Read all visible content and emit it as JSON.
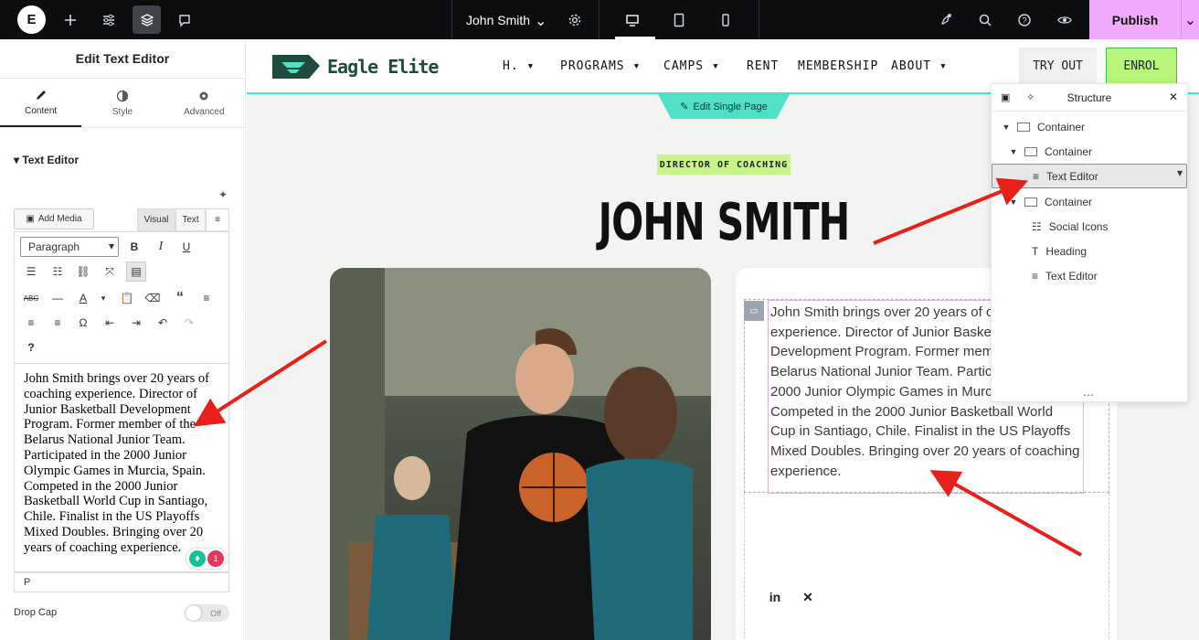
{
  "topbar": {
    "logo": "E",
    "document_title": "John Smith",
    "publish_label": "Publish"
  },
  "panel": {
    "title": "Edit Text Editor",
    "tabs": [
      {
        "label": "Content",
        "icon": "pencil-icon"
      },
      {
        "label": "Style",
        "icon": "half-circle-icon"
      },
      {
        "label": "Advanced",
        "icon": "gear-icon"
      }
    ],
    "section_title": "Text Editor",
    "add_media_label": "Add Media",
    "visual_label": "Visual",
    "text_label": "Text",
    "format_select": "Paragraph",
    "editor_text": "John Smith brings over 20 years of coaching experience. Director of Junior Basketball Development Program. Former member of the Belarus National Junior Team. Participated in the 2000 Junior Olympic Games in Murcia, Spain. Competed in the 2000 Junior Basketball World Cup in Santiago, Chile. Finalist in the US Playoffs Mixed Doubles. Bringing over 20 years of coaching experience.",
    "path_label": "P",
    "badge_count": "1",
    "drop_cap_label": "Drop Cap",
    "drop_cap_value": "Off"
  },
  "site": {
    "brand": "Eagle Elite",
    "nav": [
      {
        "label": "H.",
        "dropdown": true
      },
      {
        "label": "PROGRAMS",
        "dropdown": true
      },
      {
        "label": "CAMPS",
        "dropdown": true
      },
      {
        "label": "RENT",
        "dropdown": false
      },
      {
        "label": "MEMBERSHIP",
        "dropdown": false
      },
      {
        "label": "ABOUT",
        "dropdown": true
      }
    ],
    "try_out": "TRY OUT",
    "enrol": "ENROL",
    "edit_page": "Edit Single Page",
    "role_tag": "DIRECTOR OF COACHING",
    "name": "JOHN SMITH",
    "bio": "John Smith brings over 20 years of coaching experience. Director of Junior Basketball Development Program. Former member of the Belarus National Junior Team. Participated in the 2000 Junior Olympic Games in Murcia, Spain. Competed in the 2000 Junior Basketball World Cup in Santiago, Chile. Finalist in the US Playoffs Mixed Doubles. Bringing over 20 years of coaching experience.",
    "accent_color": "#4fe0c6",
    "tag_color": "#c8f58a"
  },
  "structure": {
    "title": "Structure",
    "items": [
      {
        "label": "Container",
        "depth": 0,
        "expanded": true
      },
      {
        "label": "Container",
        "depth": 1,
        "expanded": true
      },
      {
        "label": "Text Editor",
        "depth": 2,
        "selected": true
      },
      {
        "label": "Container",
        "depth": 1,
        "expanded": true
      },
      {
        "label": "Social Icons",
        "depth": 2
      },
      {
        "label": "Heading",
        "depth": 2
      },
      {
        "label": "Text Editor",
        "depth": 2
      }
    ]
  }
}
